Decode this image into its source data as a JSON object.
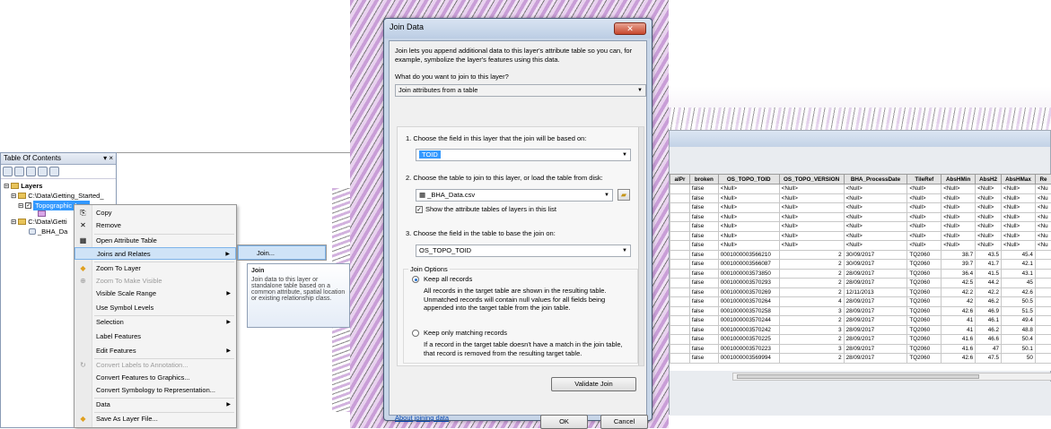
{
  "toc": {
    "title": "Table Of Contents",
    "pin_icon": "pin-icon",
    "close_glyph": "×",
    "root_label": "Layers",
    "folder1_path": "C:\\Data\\Getting_Started_",
    "layer_selected": "Topographic Area",
    "folder2_path": "C:\\Data\\Getti",
    "table_item": "_BHA_Da"
  },
  "context_menu": {
    "items": [
      {
        "label": "Copy",
        "icon": "copy-icon"
      },
      {
        "label": "Remove",
        "icon": "remove-icon"
      },
      {
        "label": "Open Attribute Table",
        "icon": "table-icon"
      },
      {
        "label": "Joins and Relates",
        "icon": "",
        "submenu": true
      },
      {
        "label": "Zoom To Layer",
        "icon": "zoom-layer-icon"
      },
      {
        "label": "Zoom To Make Visible",
        "icon": "zoom-visible-icon",
        "disabled": true
      },
      {
        "label": "Visible Scale Range",
        "submenu": true
      },
      {
        "label": "Use Symbol Levels"
      },
      {
        "label": "Selection",
        "submenu": true
      },
      {
        "label": "Label Features"
      },
      {
        "label": "Edit Features",
        "submenu": true
      },
      {
        "label": "Convert Labels to Annotation...",
        "disabled": true
      },
      {
        "label": "Convert Features to Graphics..."
      },
      {
        "label": "Convert Symbology to Representation..."
      },
      {
        "label": "Data",
        "submenu": true
      },
      {
        "label": "Save As Layer File...",
        "icon": "layer-file-icon"
      }
    ],
    "submenu_join": "Join...",
    "tooltip_title": "Join",
    "tooltip_text": "Join data to this layer or standalone table based on a common attribute, spatial location or existing relationship class."
  },
  "join_dialog": {
    "title": "Join Data",
    "close_glyph": "✕",
    "intro": "Join lets you append additional data to this layer's attribute table so you can, for example, symbolize the layer's features using this data.",
    "question": "What do you want to join to this layer?",
    "join_type": "Join attributes from a table",
    "step1": "1.  Choose the field in this layer that the join will be based on:",
    "step1_value": "TOID",
    "step2": "2.  Choose the table to join to this layer, or load the table from disk:",
    "step2_value": "_BHA_Data.csv",
    "show_attr_tables": "Show the attribute tables of layers in this list",
    "step3": "3.  Choose the field in the table to base the join on:",
    "step3_value": "OS_TOPO_TOID",
    "join_options": "Join Options",
    "opt_keep_all": "Keep all records",
    "opt_keep_all_desc": "All records in the target table are shown in the resulting table. Unmatched records will contain null values for all fields being appended into the target table from the join table.",
    "opt_keep_matching": "Keep only matching records",
    "opt_keep_matching_desc": "If a record in the target table doesn't have a match in the join table, that record is removed from the resulting target table.",
    "validate": "Validate Join",
    "about_link": "About joining data",
    "ok": "OK",
    "cancel": "Cancel"
  },
  "attr_table": {
    "columns": [
      "alPr",
      "broken",
      "OS_TOPO_TOID",
      "OS_TOPO_VERSION",
      "BHA_ProcessDate",
      "TileRef",
      "AbsHMin",
      "AbsH2",
      "AbsHMax",
      "Re"
    ],
    "rows": [
      [
        "",
        "false",
        "<Null>",
        "<Null>",
        "<Null>",
        "<Null>",
        "<Null>",
        "<Null>",
        "<Null>",
        "<Nu"
      ],
      [
        "",
        "false",
        "<Null>",
        "<Null>",
        "<Null>",
        "<Null>",
        "<Null>",
        "<Null>",
        "<Null>",
        "<Nu"
      ],
      [
        "",
        "false",
        "<Null>",
        "<Null>",
        "<Null>",
        "<Null>",
        "<Null>",
        "<Null>",
        "<Null>",
        "<Nu"
      ],
      [
        "",
        "false",
        "<Null>",
        "<Null>",
        "<Null>",
        "<Null>",
        "<Null>",
        "<Null>",
        "<Null>",
        "<Nu"
      ],
      [
        "",
        "false",
        "<Null>",
        "<Null>",
        "<Null>",
        "<Null>",
        "<Null>",
        "<Null>",
        "<Null>",
        "<Nu"
      ],
      [
        "",
        "false",
        "<Null>",
        "<Null>",
        "<Null>",
        "<Null>",
        "<Null>",
        "<Null>",
        "<Null>",
        "<Nu"
      ],
      [
        "",
        "false",
        "<Null>",
        "<Null>",
        "<Null>",
        "<Null>",
        "<Null>",
        "<Null>",
        "<Null>",
        "<Nu"
      ],
      [
        "",
        "false",
        "0001000003566210",
        "2",
        "30/09/2017",
        "TQ2060",
        "38.7",
        "43.5",
        "45.4",
        ""
      ],
      [
        "",
        "false",
        "0001000003566087",
        "2",
        "30/09/2017",
        "TQ2060",
        "39.7",
        "41.7",
        "42.1",
        ""
      ],
      [
        "",
        "false",
        "0001000003573850",
        "2",
        "28/09/2017",
        "TQ2060",
        "36.4",
        "41.5",
        "43.1",
        ""
      ],
      [
        "",
        "false",
        "0001000003570293",
        "2",
        "28/09/2017",
        "TQ2060",
        "42.5",
        "44.2",
        "45",
        ""
      ],
      [
        "",
        "false",
        "0001000003570269",
        "2",
        "12/11/2013",
        "TQ2060",
        "42.2",
        "42.2",
        "42.6",
        ""
      ],
      [
        "",
        "false",
        "0001000003570264",
        "4",
        "28/09/2017",
        "TQ2060",
        "42",
        "46.2",
        "50.5",
        ""
      ],
      [
        "",
        "false",
        "0001000003570258",
        "3",
        "28/09/2017",
        "TQ2060",
        "42.6",
        "46.9",
        "51.5",
        ""
      ],
      [
        "",
        "false",
        "0001000003570244",
        "2",
        "28/09/2017",
        "TQ2060",
        "41",
        "46.1",
        "49.4",
        ""
      ],
      [
        "",
        "false",
        "0001000003570242",
        "3",
        "28/09/2017",
        "TQ2060",
        "41",
        "46.2",
        "48.8",
        ""
      ],
      [
        "",
        "false",
        "0001000003570225",
        "2",
        "28/09/2017",
        "TQ2060",
        "41.6",
        "46.6",
        "50.4",
        ""
      ],
      [
        "",
        "false",
        "0001000003570223",
        "3",
        "28/09/2017",
        "TQ2060",
        "41.6",
        "47",
        "50.1",
        ""
      ],
      [
        "",
        "false",
        "0001000003569994",
        "2",
        "28/09/2017",
        "TQ2060",
        "42.6",
        "47.5",
        "50",
        ""
      ]
    ]
  }
}
